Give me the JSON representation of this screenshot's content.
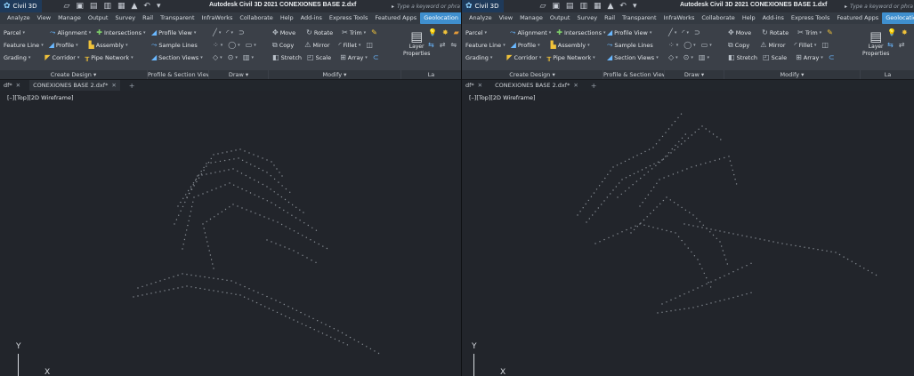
{
  "app": {
    "menu_label": "Civil 3D",
    "logo_glyph": "✿"
  },
  "qat_icons": [
    "open-icon",
    "save-icon",
    "saveas-icon",
    "print-icon",
    "plot-icon",
    "share-icon",
    "undo-icon",
    "dropdown-icon"
  ],
  "left": {
    "title": "Autodesk Civil 3D 2021   CONEXIONES BASE 2.dxf",
    "search_placeholder": "Type a keyword or phra",
    "tabs": [
      "Analyze",
      "View",
      "Manage",
      "Output",
      "Survey",
      "Rail",
      "Transparent",
      "InfraWorks",
      "Collaborate",
      "Help",
      "Add-ins",
      "Express Tools",
      "Featured Apps",
      "Geolocation"
    ],
    "active_tab": "Geolocation",
    "doc_tabs": [
      {
        "label": "df*",
        "current": false
      },
      {
        "label": "CONEXIONES BASE 2.dxf*",
        "current": true
      }
    ],
    "viewport_label": "[–][Top][2D Wireframe]"
  },
  "right": {
    "title": "Autodesk Civil 3D 2021   CONEXIONES BASE 1.dxf",
    "search_placeholder": "Type a keyword or phra",
    "tabs": [
      "Analyze",
      "View",
      "Manage",
      "Output",
      "Survey",
      "Rail",
      "Transparent",
      "InfraWorks",
      "Collaborate",
      "Help",
      "Add-ins",
      "Express Tools",
      "Featured Apps",
      "Geolocatio"
    ],
    "active_tab": "Geolocatio",
    "doc_tabs": [
      {
        "label": "df*",
        "current": false
      },
      {
        "label": "CONEXIONES BASE 2.dxf*",
        "current": false
      }
    ],
    "viewport_label": "[–][Top][2D Wireframe]"
  },
  "ribbon": {
    "create_design": {
      "label": "Create Design",
      "row1": [
        "Parcel",
        "Alignment",
        "Intersections"
      ],
      "row2": [
        "Feature Line",
        "Profile",
        "Assembly"
      ],
      "row3": [
        "Grading",
        "Corridor",
        "Pipe Network"
      ]
    },
    "profile_section": {
      "label": "Profile & Section Views",
      "row1": [
        "Profile View"
      ],
      "row2": [
        "Sample Lines"
      ],
      "row3": [
        "Section Views"
      ]
    },
    "draw": {
      "label": "Draw"
    },
    "modify": {
      "label": "Modify",
      "row1": [
        "Move",
        "Rotate",
        "Trim"
      ],
      "row2": [
        "Copy",
        "Mirror",
        "Fillet"
      ],
      "row3": [
        "Stretch",
        "Scale",
        "Array"
      ]
    },
    "layers": {
      "label": "La",
      "big_label_1": "Layer",
      "big_label_2": "Properties"
    }
  },
  "ucs": {
    "y": "Y",
    "x": "X"
  },
  "colors": {
    "accent": "#3f8fce",
    "viewport_bg": "#22252b",
    "ribbon_bg": "#3b4048",
    "dots": "#8a9097"
  }
}
